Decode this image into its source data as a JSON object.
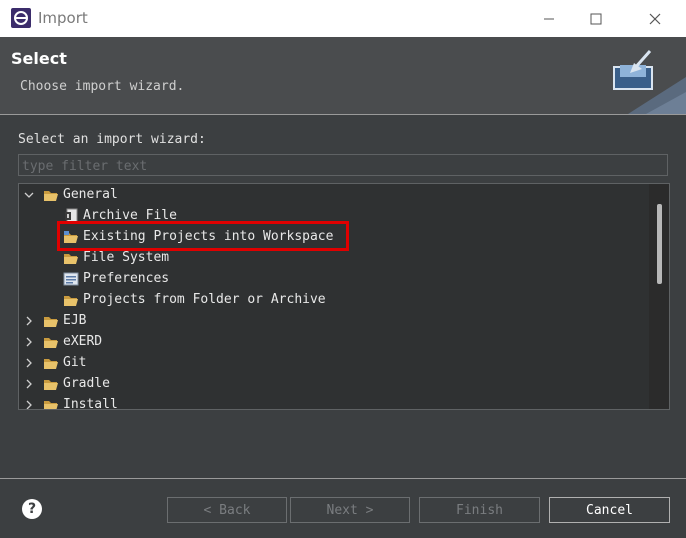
{
  "window": {
    "title": "Import"
  },
  "header": {
    "title": "Select",
    "description": "Choose import wizard."
  },
  "wizard": {
    "label": "Select an import wizard:",
    "filter_placeholder": "type filter text"
  },
  "tree": [
    {
      "label": "General",
      "expanded": true,
      "icon": "folder-open-icon",
      "children": [
        {
          "label": "Archive File",
          "icon": "archive-file-icon"
        },
        {
          "label": "Existing Projects into Workspace",
          "icon": "existing-projects-icon",
          "highlighted": true
        },
        {
          "label": "File System",
          "icon": "file-system-icon"
        },
        {
          "label": "Preferences",
          "icon": "preferences-icon"
        },
        {
          "label": "Projects from Folder or Archive",
          "icon": "folder-icon"
        }
      ]
    },
    {
      "label": "EJB",
      "expanded": false,
      "icon": "folder-icon"
    },
    {
      "label": "eXERD",
      "expanded": false,
      "icon": "folder-icon"
    },
    {
      "label": "Git",
      "expanded": false,
      "icon": "folder-icon"
    },
    {
      "label": "Gradle",
      "expanded": false,
      "icon": "folder-icon"
    },
    {
      "label": "Install",
      "expanded": false,
      "icon": "folder-icon"
    }
  ],
  "buttons": {
    "back": "< Back",
    "next": "Next >",
    "finish": "Finish",
    "cancel": "Cancel"
  },
  "colors": {
    "highlight": "#e00000",
    "background": "#3c3f41",
    "tree_background": "#2f3132"
  }
}
